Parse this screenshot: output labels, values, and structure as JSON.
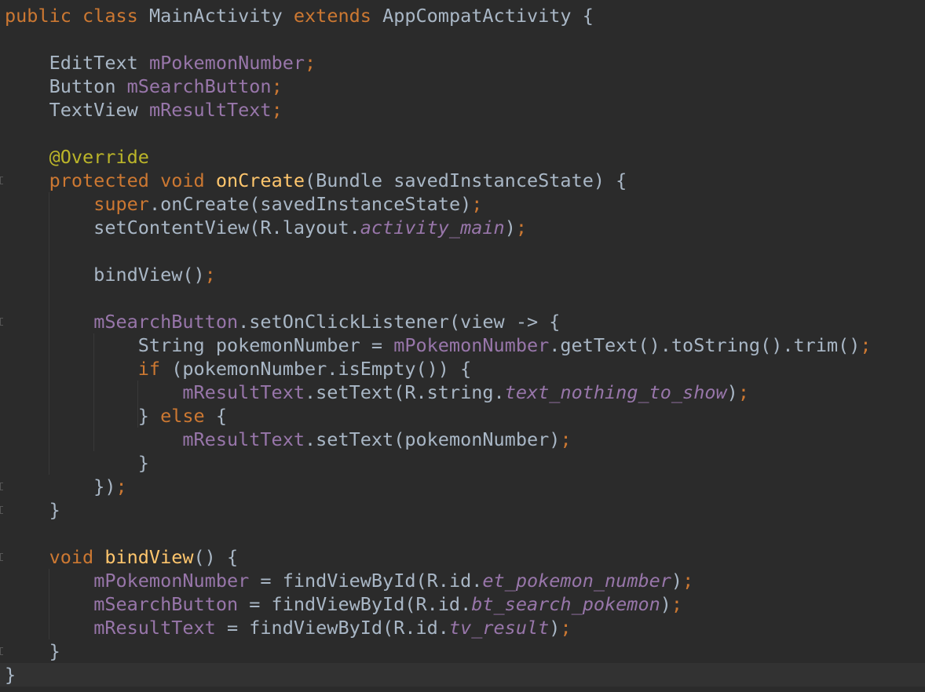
{
  "editor": {
    "language": "Java",
    "theme": "Darcula",
    "colors": {
      "background": "#2b2b2b",
      "current_line": "#323232",
      "default": "#a9b7c6",
      "keyword": "#cc7832",
      "field": "#9876aa",
      "method_decl": "#ffc66d",
      "annotation": "#bbb529",
      "gutter_mark": "#555555",
      "indent_guide": "#393939"
    },
    "folding_markers": "fold-marker-icon",
    "lines": [
      [
        {
          "t": "public class ",
          "k": "kw"
        },
        {
          "t": "MainActivity ",
          "k": "def"
        },
        {
          "t": "extends ",
          "k": "kw"
        },
        {
          "t": "AppCompatActivity {",
          "k": "def"
        }
      ],
      [],
      [
        {
          "t": "    EditText ",
          "k": "def"
        },
        {
          "t": "mPokemonNumber",
          "k": "field"
        },
        {
          "t": ";",
          "k": "kw"
        }
      ],
      [
        {
          "t": "    Button ",
          "k": "def"
        },
        {
          "t": "mSearchButton",
          "k": "field"
        },
        {
          "t": ";",
          "k": "kw"
        }
      ],
      [
        {
          "t": "    TextView ",
          "k": "def"
        },
        {
          "t": "mResultText",
          "k": "field"
        },
        {
          "t": ";",
          "k": "kw"
        }
      ],
      [],
      [
        {
          "t": "    ",
          "k": "def"
        },
        {
          "t": "@Override",
          "k": "ann"
        }
      ],
      [
        {
          "t": "    ",
          "k": "def"
        },
        {
          "t": "protected void ",
          "k": "kw"
        },
        {
          "t": "onCreate",
          "k": "mdecl"
        },
        {
          "t": "(Bundle savedInstanceState) {",
          "k": "def"
        }
      ],
      [
        {
          "t": "        ",
          "k": "def"
        },
        {
          "t": "super",
          "k": "kw"
        },
        {
          "t": ".onCreate(savedInstanceState)",
          "k": "def"
        },
        {
          "t": ";",
          "k": "kw"
        }
      ],
      [
        {
          "t": "        setContentView(R.layout.",
          "k": "def"
        },
        {
          "t": "activity_main",
          "k": "fieldi"
        },
        {
          "t": ")",
          "k": "def"
        },
        {
          "t": ";",
          "k": "kw"
        }
      ],
      [],
      [
        {
          "t": "        bindView()",
          "k": "def"
        },
        {
          "t": ";",
          "k": "kw"
        }
      ],
      [],
      [
        {
          "t": "        ",
          "k": "def"
        },
        {
          "t": "mSearchButton",
          "k": "field"
        },
        {
          "t": ".setOnClickListener(view -> {",
          "k": "def"
        }
      ],
      [
        {
          "t": "            String pokemonNumber = ",
          "k": "def"
        },
        {
          "t": "mPokemonNumber",
          "k": "field"
        },
        {
          "t": ".getText().toString().trim()",
          "k": "def"
        },
        {
          "t": ";",
          "k": "kw"
        }
      ],
      [
        {
          "t": "            ",
          "k": "def"
        },
        {
          "t": "if ",
          "k": "kw"
        },
        {
          "t": "(pokemonNumber.isEmpty()) {",
          "k": "def"
        }
      ],
      [
        {
          "t": "                ",
          "k": "def"
        },
        {
          "t": "mResultText",
          "k": "field"
        },
        {
          "t": ".setText(R.string.",
          "k": "def"
        },
        {
          "t": "text_nothing_to_show",
          "k": "fieldi"
        },
        {
          "t": ")",
          "k": "def"
        },
        {
          "t": ";",
          "k": "kw"
        }
      ],
      [
        {
          "t": "            } ",
          "k": "def"
        },
        {
          "t": "else ",
          "k": "kw"
        },
        {
          "t": "{",
          "k": "def"
        }
      ],
      [
        {
          "t": "                ",
          "k": "def"
        },
        {
          "t": "mResultText",
          "k": "field"
        },
        {
          "t": ".setText(pokemonNumber)",
          "k": "def"
        },
        {
          "t": ";",
          "k": "kw"
        }
      ],
      [
        {
          "t": "            }",
          "k": "def"
        }
      ],
      [
        {
          "t": "        })",
          "k": "def"
        },
        {
          "t": ";",
          "k": "kw"
        }
      ],
      [
        {
          "t": "    }",
          "k": "def"
        }
      ],
      [],
      [
        {
          "t": "    ",
          "k": "def"
        },
        {
          "t": "void ",
          "k": "kw"
        },
        {
          "t": "bindView",
          "k": "mdecl"
        },
        {
          "t": "() {",
          "k": "def"
        }
      ],
      [
        {
          "t": "        ",
          "k": "def"
        },
        {
          "t": "mPokemonNumber ",
          "k": "field"
        },
        {
          "t": "= findViewById(R.id.",
          "k": "def"
        },
        {
          "t": "et_pokemon_number",
          "k": "fieldi"
        },
        {
          "t": ")",
          "k": "def"
        },
        {
          "t": ";",
          "k": "kw"
        }
      ],
      [
        {
          "t": "        ",
          "k": "def"
        },
        {
          "t": "mSearchButton ",
          "k": "field"
        },
        {
          "t": "= findViewById(R.id.",
          "k": "def"
        },
        {
          "t": "bt_search_pokemon",
          "k": "fieldi"
        },
        {
          "t": ")",
          "k": "def"
        },
        {
          "t": ";",
          "k": "kw"
        }
      ],
      [
        {
          "t": "        ",
          "k": "def"
        },
        {
          "t": "mResultText ",
          "k": "field"
        },
        {
          "t": "= findViewById(R.id.",
          "k": "def"
        },
        {
          "t": "tv_result",
          "k": "fieldi"
        },
        {
          "t": ")",
          "k": "def"
        },
        {
          "t": ";",
          "k": "kw"
        }
      ],
      [
        {
          "t": "    }",
          "k": "def"
        }
      ],
      [
        {
          "t": "}",
          "k": "def"
        }
      ]
    ]
  }
}
